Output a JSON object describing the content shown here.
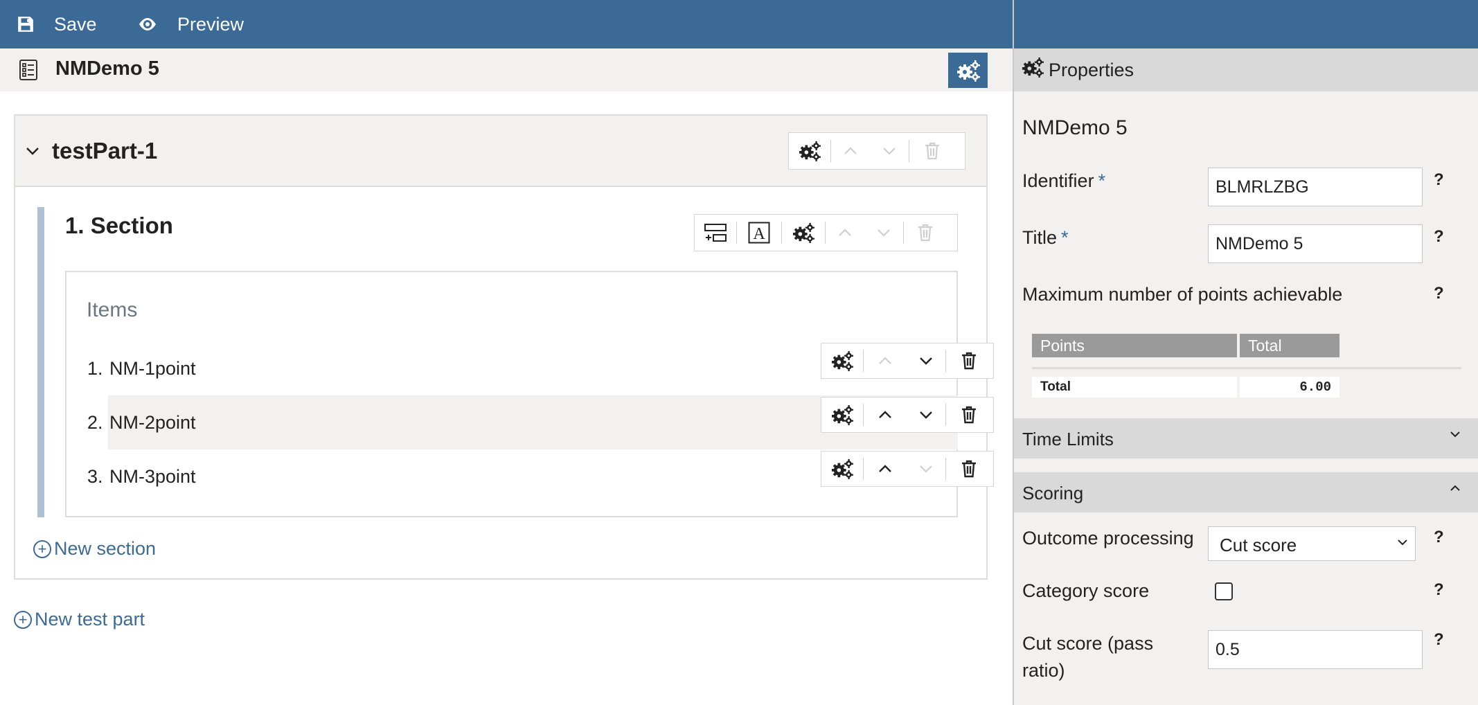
{
  "topbar": {
    "save_label": "Save",
    "preview_label": "Preview"
  },
  "test": {
    "title": "NMDemo 5"
  },
  "test_part": {
    "title": "testPart-1"
  },
  "section": {
    "title": "1. Section",
    "items_heading": "Items",
    "items": [
      {
        "num": "1.",
        "label": "NM-1point"
      },
      {
        "num": "2.",
        "label": "NM-2point"
      },
      {
        "num": "3.",
        "label": "NM-3point"
      }
    ],
    "new_section_label": "New section"
  },
  "new_test_part_label": "New test part",
  "properties": {
    "header": "Properties",
    "name": "NMDemo 5",
    "identifier_label": "Identifier",
    "identifier_value": "BLMRLZBG",
    "title_label": "Title",
    "title_value": "NMDemo 5",
    "required_mark": "*",
    "help_mark": "?",
    "max_points_label": "Maximum number of points achievable",
    "points_table": {
      "col_points": "Points",
      "col_total": "Total",
      "row_label": "Total",
      "row_value": "6.00"
    },
    "time_limits_label": "Time Limits",
    "scoring_label": "Scoring",
    "outcome_processing_label": "Outcome processing",
    "outcome_processing_value": "Cut score",
    "category_score_label": "Category score",
    "cut_score_label": "Cut score (pass ratio)",
    "cut_score_value": "0.5"
  },
  "colors": {
    "accent": "#3b6a97",
    "panel": "#f2f1ef",
    "section_bar": "#aec2d5"
  }
}
